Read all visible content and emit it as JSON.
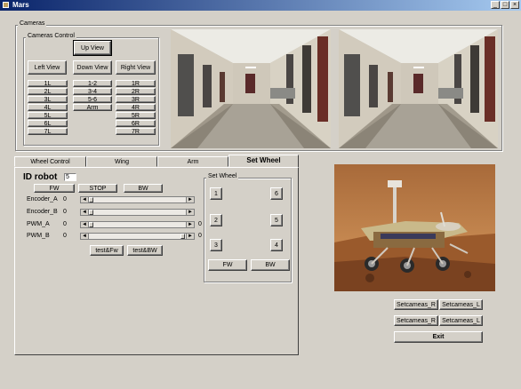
{
  "window": {
    "title": "Mars",
    "min": "_",
    "max": "□",
    "close": "×"
  },
  "cameras": {
    "group_label": "Cameras",
    "control_label": "Cameras Control",
    "up_view": "Up View",
    "left_view": "Left View",
    "down_view": "Down View",
    "right_view": "Right View",
    "left_buttons": [
      "1L",
      "2L",
      "3L",
      "4L",
      "5L",
      "6L",
      "7L"
    ],
    "mid_buttons": [
      "1-2",
      "3-4",
      "5-6",
      "Arm"
    ],
    "right_buttons": [
      "1R",
      "2R",
      "3R",
      "4R",
      "5R",
      "6R",
      "7R"
    ]
  },
  "tabs": [
    "Wheel Control",
    "Wing",
    "Arm",
    "Set Wheel"
  ],
  "wheel": {
    "id_label": "ID  robot",
    "id_value": "5",
    "fw": "FW",
    "stop": "STOP",
    "bw": "BW",
    "rows": [
      {
        "label": "Encoder_A",
        "value": "0",
        "right": ""
      },
      {
        "label": "Encoder_B",
        "value": "0",
        "right": ""
      },
      {
        "label": "PWM_A",
        "value": "0",
        "right": "0"
      },
      {
        "label": "PWM_B",
        "value": "0",
        "right": "0"
      }
    ],
    "test_fw": "test&Fw",
    "test_bw": "test&BW"
  },
  "set_wheel": {
    "label": "Set Wheel",
    "left": [
      "1",
      "2",
      "3"
    ],
    "right": [
      "6",
      "5",
      "4"
    ],
    "fw": "FW",
    "bw": "BW"
  },
  "set_camera_buttons": [
    "Setcameas_R",
    "Setcameas_L",
    "Setcameas_R",
    "Setcameas_L"
  ],
  "exit": "Exit",
  "icons": {
    "scroll_left": "◄",
    "scroll_right": "►"
  }
}
